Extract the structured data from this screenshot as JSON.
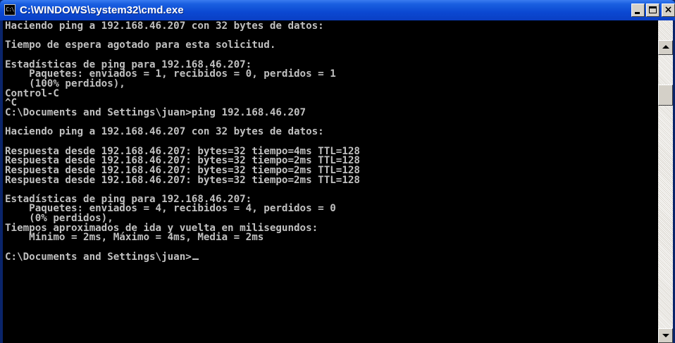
{
  "window": {
    "title": "C:\\WINDOWS\\system32\\cmd.exe",
    "icon_label": "C:\\",
    "minimize_icon": "minimize-icon",
    "maximize_icon": "maximize-icon",
    "close_glyph": "×"
  },
  "console": {
    "lines": [
      "Haciendo ping a 192.168.46.207 con 32 bytes de datos:",
      "",
      "Tiempo de espera agotado para esta solicitud.",
      "",
      "Estadísticas de ping para 192.168.46.207:",
      "    Paquetes: enviados = 1, recibidos = 0, perdidos = 1",
      "    (100% perdidos),",
      "Control-C",
      "^C",
      "C:\\Documents and Settings\\juan>ping 192.168.46.207",
      "",
      "Haciendo ping a 192.168.46.207 con 32 bytes de datos:",
      "",
      "Respuesta desde 192.168.46.207: bytes=32 tiempo=4ms TTL=128",
      "Respuesta desde 192.168.46.207: bytes=32 tiempo=2ms TTL=128",
      "Respuesta desde 192.168.46.207: bytes=32 tiempo=2ms TTL=128",
      "Respuesta desde 192.168.46.207: bytes=32 tiempo=2ms TTL=128",
      "",
      "Estadísticas de ping para 192.168.46.207:",
      "    Paquetes: enviados = 4, recibidos = 4, perdidos = 0",
      "    (0% perdidos),",
      "Tiempos aproximados de ida y vuelta en milisegundos:",
      "    Mínimo = 2ms, Máximo = 4ms, Media = 2ms",
      ""
    ],
    "prompt": "C:\\Documents and Settings\\juan>"
  },
  "colors": {
    "console_background": "#000000",
    "console_text": "#c0c0c0",
    "titlebar": "#0b48d2",
    "title_text": "#ffffff"
  },
  "scrollbar": {
    "up_icon": "scroll-up-arrow-icon",
    "down_icon": "scroll-down-arrow-icon"
  }
}
